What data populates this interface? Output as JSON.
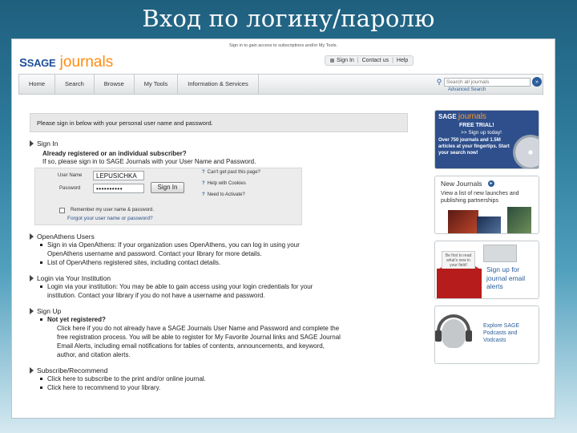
{
  "slide_title": "Вход по логину/паролю",
  "top_notice": "Sign in to gain access to subscriptions and/or My Tools.",
  "logo": {
    "brand": "SAGE",
    "product": "journals"
  },
  "utility": {
    "signin": "Sign In",
    "contact": "Contact us",
    "help": "Help",
    "sep": "|"
  },
  "nav": [
    "Home",
    "Search",
    "Browse",
    "My Tools",
    "Information & Services"
  ],
  "search": {
    "placeholder": "Search all journals",
    "advanced": "Advanced Search",
    "go": "»"
  },
  "notice": "Please sign in below with your personal user name and password.",
  "signin": {
    "heading": "Sign In",
    "subheading": "Already registered or an individual subscriber?",
    "intro": "If so, please sign in to SAGE Journals with your User Name and Password.",
    "username_label": "User Name",
    "username_value": "LEPUSICHKA",
    "password_label": "Password",
    "password_value": "••••••••••",
    "button": "Sign In",
    "link1": "Can't get past this page?",
    "link2": "Help with Cookies",
    "link3": "Need to Activate?",
    "remember": "Remember my user name & password.",
    "forgot": "Forgot your user name or password?"
  },
  "openathens": {
    "heading": "OpenAthens Users",
    "item1a": "Sign in via OpenAthens: If your organization uses OpenAthens, you can log in using your",
    "item1b": "OpenAthens username and password. Contact your library for more details.",
    "item2": "List of OpenAthens registered sites, including contact details."
  },
  "institution": {
    "heading": "Login via Your Institution",
    "item1a": "Login via your institution: You may be able to gain access using your login credentials for your",
    "item1b": "institution. Contact your library if you do not have a username and password."
  },
  "signup": {
    "heading": "Sign Up",
    "bold": "Not yet registered?",
    "line1": "Click here if you do not already have a SAGE Journals User Name and Password and complete the",
    "line2": "free registration process. You will be able to register for My Favorite Journal links and SAGE Journal",
    "line3": "Email Alerts, including email notifications for tables of contents, announcements, and keyword,",
    "line4": "author, and citation alerts."
  },
  "subscribe": {
    "heading": "Subscribe/Recommend",
    "item1": "Click here to subscribe to the print and/or online journal.",
    "item2": "Click here to recommend to your library."
  },
  "sidebar": {
    "trial": {
      "brand": "SAGE",
      "product": "journals",
      "free_trial": "FREE TRIAL!",
      "signup": ">> Sign up today!",
      "body": "Over 750 journals and 1.5M articles at your fingertips. Start your search now!"
    },
    "new_journals": {
      "title": "New Journals",
      "body": "View a list of new launches and publishing partnerships"
    },
    "email": {
      "paper": "Be first to read what's new in your field!",
      "body": "Sign up for journal email alerts"
    },
    "podcasts": {
      "body": "Explore SAGE Podcasts and Vodcasts"
    }
  },
  "colors": {
    "brand_blue": "#1e4f9a",
    "brand_orange": "#ff8c12",
    "slide_bg": "#2d7a9b"
  }
}
